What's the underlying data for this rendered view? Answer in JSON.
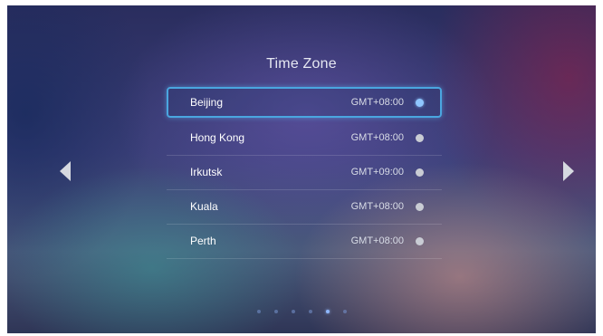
{
  "screen": {
    "title": "Time Zone"
  },
  "timezones": [
    {
      "city": "Beijing",
      "offset": "GMT+08:00",
      "selected": true
    },
    {
      "city": "Hong Kong",
      "offset": "GMT+08:00",
      "selected": false
    },
    {
      "city": "Irkutsk",
      "offset": "GMT+09:00",
      "selected": false
    },
    {
      "city": "Kuala",
      "offset": "GMT+08:00",
      "selected": false
    },
    {
      "city": "Perth",
      "offset": "GMT+08:00",
      "selected": false
    }
  ],
  "navigation": {
    "left_icon": "caret-left-icon",
    "right_icon": "caret-right-icon"
  },
  "pagination": {
    "page_count": 6,
    "current_page": 5
  },
  "colors": {
    "selection_border": "#4aa6e0",
    "selected_radio": "#8fc6ff",
    "unselected_radio": "#c9ccd4"
  }
}
